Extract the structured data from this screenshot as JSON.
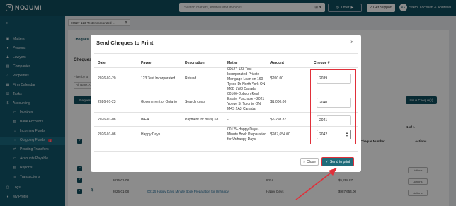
{
  "app": {
    "logo_text": "NOJUMI"
  },
  "topbar": {
    "search_placeholder": "Search matters, entities and invoices",
    "timer_label": "Timer",
    "support_label": "Get Support",
    "user_initials": "SA",
    "user_name": "Stern, Lockhart & Andrews"
  },
  "sidebar": {
    "items": [
      {
        "label": "Matters",
        "icon": "briefcase-icon"
      },
      {
        "label": "Persons",
        "icon": "person-icon"
      },
      {
        "label": "Lawyers",
        "icon": "lawyer-icon"
      },
      {
        "label": "Companies",
        "icon": "building-icon"
      },
      {
        "label": "Properties",
        "icon": "home-icon"
      },
      {
        "label": "Firm Calendar",
        "icon": "calendar-icon"
      },
      {
        "label": "Tasks",
        "icon": "tasks-icon"
      },
      {
        "label": "Accounting",
        "icon": "accounting-icon"
      },
      {
        "label": "Invoices",
        "icon": "invoice-icon"
      },
      {
        "label": "Bank Accounts",
        "icon": "bank-icon"
      },
      {
        "label": "Incoming Funds",
        "icon": "incoming-icon"
      },
      {
        "label": "Outgoing Funds",
        "icon": "outgoing-icon",
        "badge": "4"
      },
      {
        "label": "Pending Transfers",
        "icon": "transfer-icon"
      },
      {
        "label": "Accounts Payable",
        "icon": "payable-icon"
      },
      {
        "label": "Reports",
        "icon": "report-icon"
      },
      {
        "label": "Transactions",
        "icon": "transactions-icon"
      },
      {
        "label": "Logs",
        "icon": "logs-icon"
      },
      {
        "label": "My Profile",
        "icon": "profile-icon"
      }
    ]
  },
  "background": {
    "matter_tag": "00527-123 Test Incorporated-...",
    "tab": "Cheques",
    "heading": "Cheques",
    "filter_label": "Filter by B",
    "filter_value": "All Bank A",
    "request_btn": "Reques",
    "issue_btn": "Issue Cheque(s)",
    "cheque_number_col": "Cheque Number",
    "actions_col": "Actions",
    "action_btn": "Actions",
    "pager": [
      "1 of 1"
    ],
    "rows": [
      {
        "date": "2026-01-08",
        "matter": "00125 Happy Days Minute Book Preparation for Unhappy",
        "payee": "IKEA",
        "amount": "$5,298.87"
      },
      {
        "date": "2026-01-08",
        "matter": "00125 Happy Days Minute Book Preparation for Unhappy",
        "payee": "Happy Days",
        "amount": "$987,654.00"
      }
    ]
  },
  "modal": {
    "title": "Send Cheques to Print",
    "headers": {
      "date": "Date",
      "payee": "Payee",
      "description": "Description",
      "matter": "Matter",
      "amount": "Amount",
      "cheque": "Cheque #"
    },
    "rows": [
      {
        "date": "2026-02-20",
        "payee": "123 Test Incorporated",
        "description": "Refund",
        "matter": "00527-123 Test Incorporated-Private Mortgage Loan on 160 Tycos Dr North York ON M6B 1W8 Canada",
        "amount": "$200.00",
        "cheque": "2039"
      },
      {
        "date": "2026-01-23",
        "payee": "Government of Ontario",
        "description": "Search costs",
        "matter": "00106-Dobson-Real Estate Purchase - 2021 Yonge St Toronto ON M4S 2A3 Canada",
        "amount": "$1,000.00",
        "cheque": "2040"
      },
      {
        "date": "2026-01-08",
        "payee": "IKEA",
        "description": "Payment for bill(s) 68",
        "matter": "-",
        "amount": "$5,298.87",
        "cheque": "2041"
      },
      {
        "date": "2026-01-08",
        "payee": "Happy Days",
        "description": "",
        "matter": "00125-Happy Days-Minute Book Preparation for Unhappy Days",
        "amount": "$987,654.00",
        "cheque": "2042"
      }
    ],
    "close_label": "Close",
    "send_label": "Send to print"
  },
  "colors": {
    "brand": "#0f4e5e",
    "highlight": "#e0303a",
    "primary_button": "#1f6c7a"
  }
}
